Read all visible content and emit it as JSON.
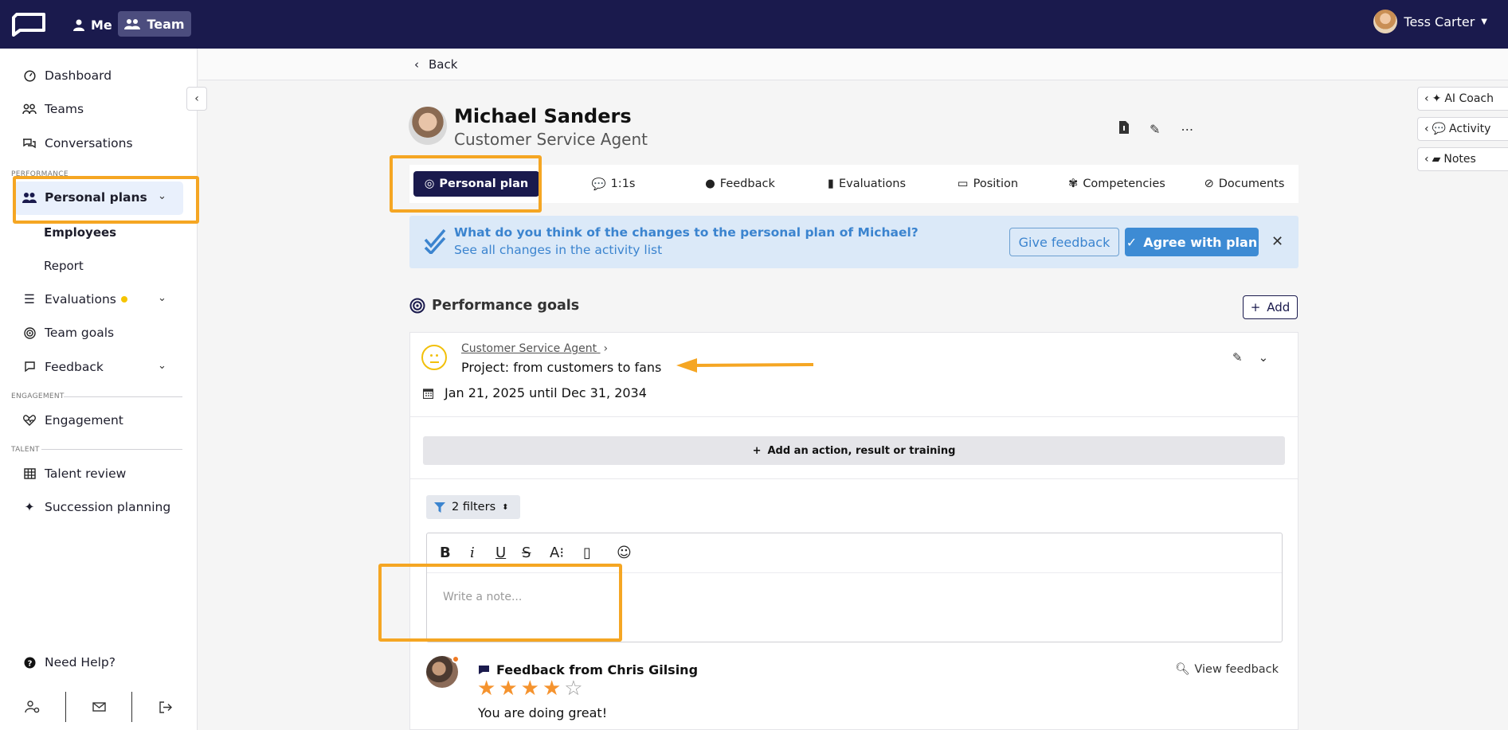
{
  "topbar": {
    "me_label": "Me",
    "team_label": "Team",
    "user_name": "Tess Carter"
  },
  "sidebar": {
    "items": [
      {
        "label": "Dashboard",
        "icon": "gauge-icon"
      },
      {
        "label": "Teams",
        "icon": "users-icon"
      },
      {
        "label": "Conversations",
        "icon": "chat-icon"
      }
    ],
    "section_performance": "PERFORMANCE",
    "active_item": "Personal plans",
    "sub_items": [
      "Employees",
      "Report"
    ],
    "evaluations": "Evaluations",
    "team_goals": "Team goals",
    "feedback": "Feedback",
    "section_engagement": "ENGAGEMENT",
    "engagement": "Engagement",
    "section_talent": "TALENT",
    "talent_review": "Talent review",
    "succession": "Succession planning",
    "help": "Need Help?"
  },
  "main": {
    "back": "Back",
    "profile": {
      "name": "Michael Sanders",
      "role": "Customer Service Agent"
    },
    "tabs": [
      "Personal plan",
      "1:1s",
      "Feedback",
      "Evaluations",
      "Position",
      "Competencies",
      "Documents"
    ],
    "banner": {
      "question": "What do you think of the changes to the personal plan of Michael?",
      "link": "See all changes in the activity list",
      "give_feedback": "Give feedback",
      "agree": "Agree with plan"
    },
    "goals": {
      "title": "Performance goals",
      "add": "Add",
      "breadcrumb": "Customer Service Agent",
      "goal_title": "Project: from customers to fans",
      "dates": "Jan 21, 2025 until Dec 31, 2034",
      "add_action": "Add an action, result or training",
      "filters": "2 filters",
      "note_placeholder": "Write a note..."
    },
    "feedback_item": {
      "title": "Feedback from Chris Gilsing",
      "rating": 4,
      "max_rating": 5,
      "text": "You are doing great!",
      "view": "View feedback"
    }
  },
  "right_panel": {
    "items": [
      "AI Coach",
      "Activity",
      "Notes"
    ]
  },
  "colors": {
    "navy": "#1a1a4d",
    "accent_blue": "#3d8bd4",
    "highlight": "#f5a623",
    "star": "#f5932e"
  }
}
